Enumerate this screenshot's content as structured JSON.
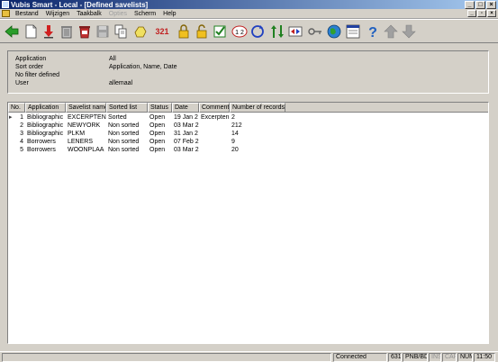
{
  "window": {
    "title": "Vubis Smart - Local - [Defined savelists]"
  },
  "menu": [
    {
      "label": "Bestand",
      "disabled": false
    },
    {
      "label": "Wijzigen",
      "disabled": false
    },
    {
      "label": "Taakbalk",
      "disabled": false
    },
    {
      "label": "Opties",
      "disabled": true
    },
    {
      "label": "Scherm",
      "disabled": false
    },
    {
      "label": "Help",
      "disabled": false
    }
  ],
  "toolbar": {
    "sort_label": "321"
  },
  "info": [
    {
      "label": "Application",
      "value": "All"
    },
    {
      "label": "Sort order",
      "value": "Application, Name, Date"
    },
    {
      "label": "No filter defined",
      "value": ""
    },
    {
      "label": "User",
      "value": "allemaal"
    }
  ],
  "table": {
    "columns": [
      "No.",
      "Application",
      "Savelist name",
      "Sorted list",
      "Status",
      "Date",
      "Comment",
      "Number of records"
    ],
    "rows": [
      [
        "1",
        "Bibliographic",
        "EXCERPTEN",
        "Sorted",
        "Open",
        "19 Jan 2",
        "Excerpten",
        "2"
      ],
      [
        "2",
        "Bibliographic",
        "NEWYORK",
        "Non sorted",
        "Open",
        "03 Mar 2",
        "",
        "212"
      ],
      [
        "3",
        "Bibliographic",
        "PLKM",
        "Non sorted",
        "Open",
        "31 Jan 2",
        "",
        "14"
      ],
      [
        "4",
        "Borrowers",
        "LENERS",
        "Non sorted",
        "Open",
        "07 Feb 2",
        "",
        "9"
      ],
      [
        "5",
        "Borrowers",
        "WOONPLAA",
        "Non sorted",
        "Open",
        "03 Mar 2",
        "",
        "20"
      ]
    ]
  },
  "status": {
    "connected": "Connected",
    "count": "631",
    "db": "PNB/BD",
    "ins": "INS",
    "caps": "CAPS",
    "num": "NUM",
    "time": "11:50"
  },
  "colors": {
    "titlebar": "#0a246a",
    "chrome": "#d4d0c8"
  }
}
